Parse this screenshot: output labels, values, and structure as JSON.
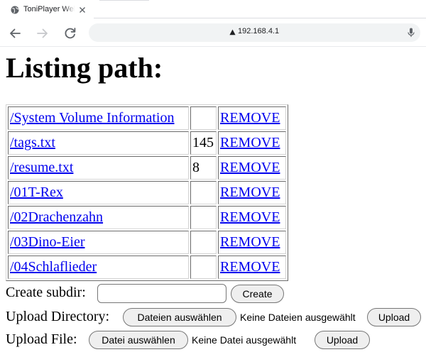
{
  "browser": {
    "tab_title": "ToniPlayer Web",
    "url": "192.168.4.1",
    "icons": {
      "favicon": "globe-icon",
      "close": "close-icon",
      "back": "back-arrow-icon",
      "forward": "forward-arrow-icon",
      "reload": "reload-icon",
      "security": "warning-triangle-icon",
      "voice": "microphone-icon"
    }
  },
  "page": {
    "title": "Listing path:",
    "link_color": "#0000ee",
    "entries": [
      {
        "path": "/System Volume Information",
        "size": "",
        "action": "REMOVE"
      },
      {
        "path": "/tags.txt",
        "size": "145",
        "action": "REMOVE"
      },
      {
        "path": "/resume.txt",
        "size": "8",
        "action": "REMOVE"
      },
      {
        "path": "/01T-Rex",
        "size": "",
        "action": "REMOVE"
      },
      {
        "path": "/02Drachenzahn",
        "size": "",
        "action": "REMOVE"
      },
      {
        "path": "/03Dino-Eier",
        "size": "",
        "action": "REMOVE"
      },
      {
        "path": "/04Schlaflieder",
        "size": "",
        "action": "REMOVE"
      }
    ],
    "create_subdir": {
      "label": "Create subdir:",
      "value": "",
      "button": "Create"
    },
    "upload_directory": {
      "label": "Upload Directory:",
      "choose_button": "Dateien auswählen",
      "status": "Keine Dateien ausgewählt",
      "upload_button": "Upload"
    },
    "upload_file": {
      "label": "Upload File:",
      "choose_button": "Datei auswählen",
      "status": "Keine Datei ausgewählt",
      "upload_button": "Upload"
    }
  }
}
